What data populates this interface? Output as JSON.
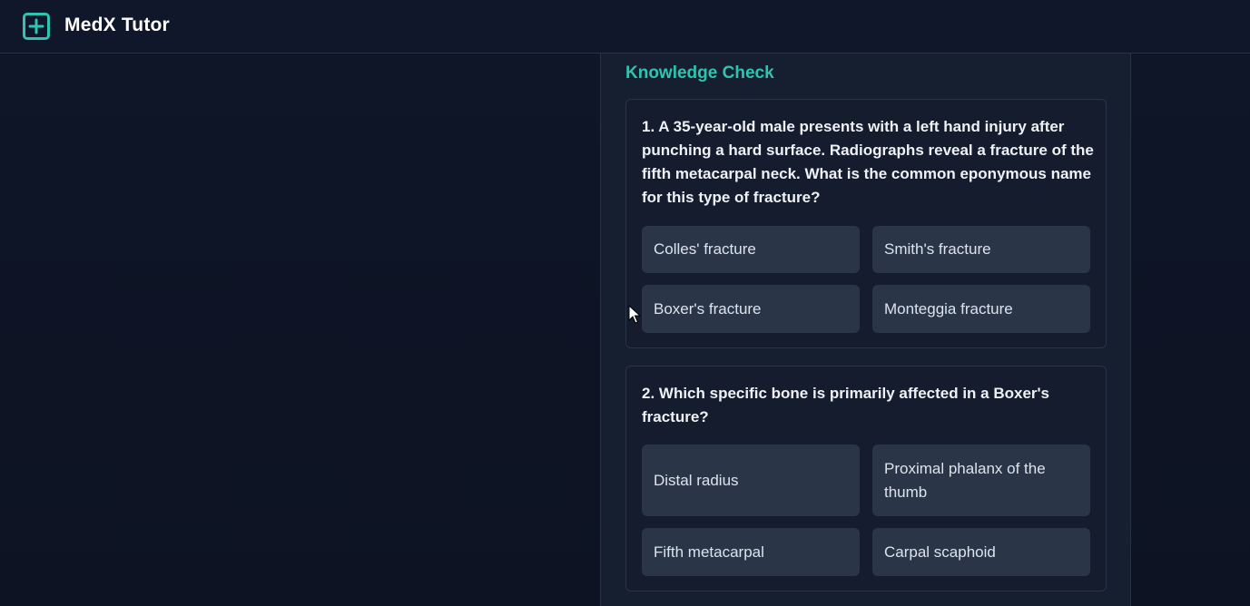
{
  "header": {
    "title": "MedX Tutor",
    "logo_icon": "plus-square-icon",
    "accent": "#2fc4b2"
  },
  "knowledge_check": {
    "title": "Knowledge Check",
    "questions": [
      {
        "text": "1. A 35-year-old male presents with a left hand injury after punching a hard surface. Radiographs reveal a fracture of the fifth metacarpal neck. What is the common eponymous name for this type of fracture?",
        "options": [
          "Colles' fracture",
          "Smith's fracture",
          "Boxer's fracture",
          "Monteggia fracture"
        ]
      },
      {
        "text": "2. Which specific bone is primarily affected in a Boxer's fracture?",
        "options": [
          "Distal radius",
          "Proximal phalanx of the thumb",
          "Fifth metacarpal",
          "Carpal scaphoid"
        ]
      }
    ]
  }
}
